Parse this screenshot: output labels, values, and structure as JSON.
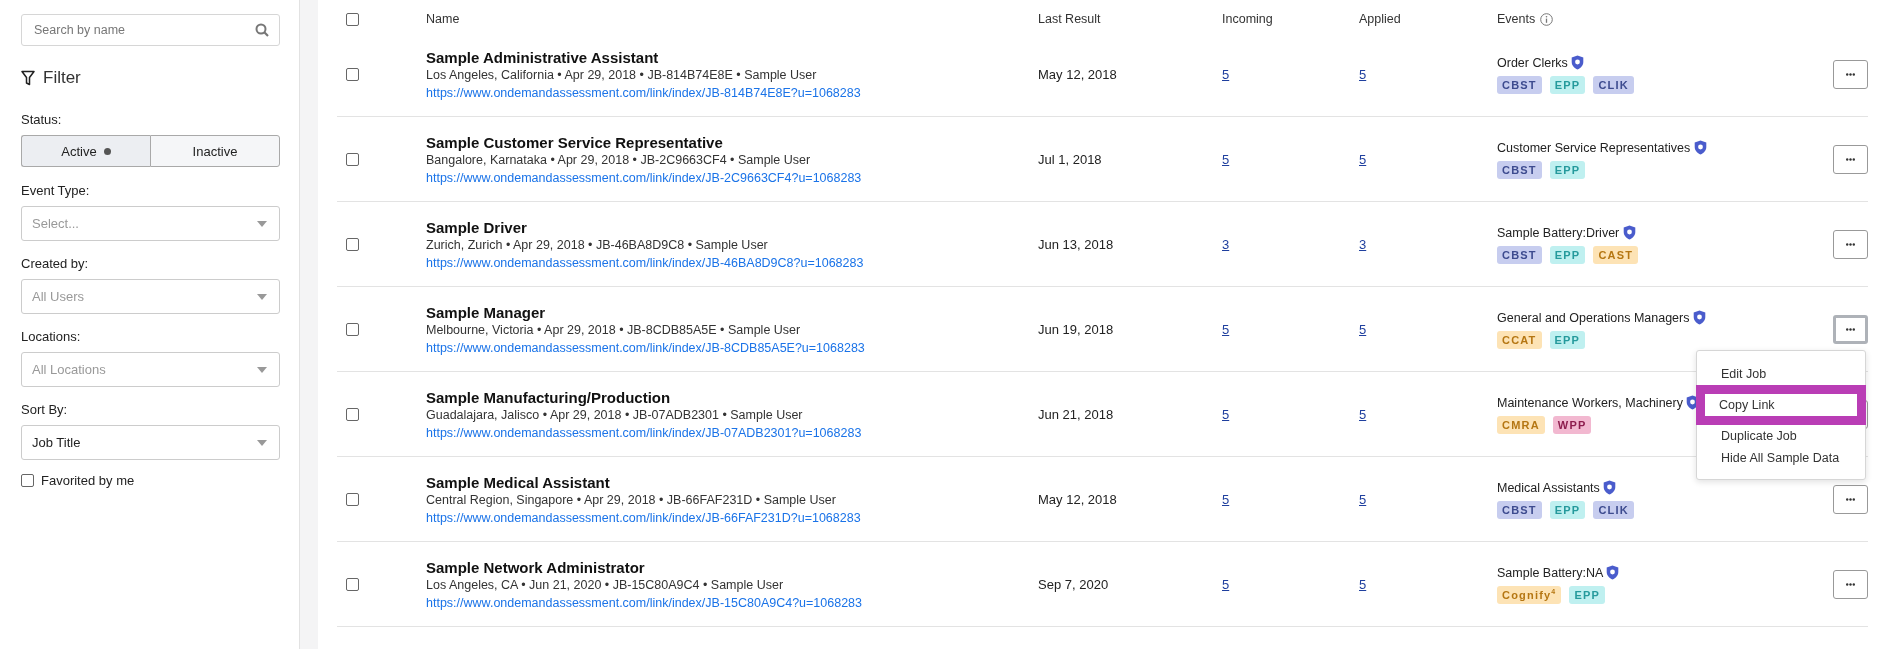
{
  "sidebar": {
    "search": {
      "placeholder": "Search by name"
    },
    "filter_title": "Filter",
    "status": {
      "label": "Status:",
      "options": [
        {
          "label": "Active",
          "selected": true
        },
        {
          "label": "Inactive",
          "selected": false
        }
      ]
    },
    "selects": [
      {
        "label": "Event Type:",
        "value": "Select...",
        "placeholder": true
      },
      {
        "label": "Created by:",
        "value": "All Users",
        "placeholder": true
      },
      {
        "label": "Locations:",
        "value": "All Locations",
        "placeholder": true
      },
      {
        "label": "Sort By:",
        "value": "Job Title",
        "placeholder": false
      }
    ],
    "favorited": {
      "label": "Favorited by me",
      "checked": false
    }
  },
  "table": {
    "select_all": {
      "checked": false
    },
    "columns": [
      "Name",
      "Last Result",
      "Incoming",
      "Applied",
      "Events"
    ],
    "rows": [
      {
        "checked": false,
        "name": "Sample Administrative Assistant",
        "meta": "Los Angeles, California • Apr 29, 2018 • JB-814B74E8E • Sample User",
        "link": "https://www.ondemandassessment.com/link/index/JB-814B74E8E?u=1068283",
        "last_result": "May 12, 2018",
        "incoming": "5",
        "applied": "5",
        "event": "Order Clerks",
        "tags": [
          {
            "label": "CBST",
            "color": "#c7cdef"
          },
          {
            "label": "EPP",
            "color": "#bff0f0"
          },
          {
            "label": "CLIK",
            "color": "#c7cdef"
          }
        ]
      },
      {
        "checked": false,
        "name": "Sample Customer Service Representative",
        "meta": "Bangalore, Karnataka • Apr 29, 2018 • JB-2C9663CF4 • Sample User",
        "link": "https://www.ondemandassessment.com/link/index/JB-2C9663CF4?u=1068283",
        "last_result": "Jul 1, 2018",
        "incoming": "5",
        "applied": "5",
        "event": "Customer Service Representatives",
        "tags": [
          {
            "label": "CBST",
            "color": "#c7cdef"
          },
          {
            "label": "EPP",
            "color": "#bff0f0"
          }
        ]
      },
      {
        "checked": false,
        "name": "Sample Driver",
        "meta": "Zurich, Zurich • Apr 29, 2018 • JB-46BA8D9C8 • Sample User",
        "link": "https://www.ondemandassessment.com/link/index/JB-46BA8D9C8?u=1068283",
        "last_result": "Jun 13, 2018",
        "incoming": "3",
        "applied": "3",
        "event": "Sample Battery:Driver",
        "tags": [
          {
            "label": "CBST",
            "color": "#c7cdef"
          },
          {
            "label": "EPP",
            "color": "#bff0f0"
          },
          {
            "label": "CAST",
            "color": "#fde3b5"
          }
        ]
      },
      {
        "checked": false,
        "name": "Sample Manager",
        "meta": "Melbourne, Victoria • Apr 29, 2018 • JB-8CDB85A5E • Sample User",
        "link": "https://www.ondemandassessment.com/link/index/JB-8CDB85A5E?u=1068283",
        "last_result": "Jun 19, 2018",
        "incoming": "5",
        "applied": "5",
        "event": "General and Operations Managers",
        "tags": [
          {
            "label": "CCAT",
            "color": "#fde3b5"
          },
          {
            "label": "EPP",
            "color": "#bff0f0"
          }
        ],
        "menu": {
          "items": [
            {
              "label": "Edit Job",
              "selected": false
            },
            {
              "label": "Copy Link",
              "selected": true
            },
            {
              "label": "Duplicate Job",
              "selected": false
            },
            {
              "label": "Hide All Sample Data",
              "selected": false
            }
          ]
        }
      },
      {
        "checked": false,
        "name": "Sample Manufacturing/Production",
        "meta": "Guadalajara, Jalisco • Apr 29, 2018 • JB-07ADB2301 • Sample User",
        "link": "https://www.ondemandassessment.com/link/index/JB-07ADB2301?u=1068283",
        "last_result": "Jun 21, 2018",
        "incoming": "5",
        "applied": "5",
        "event": "Maintenance Workers, Machinery",
        "tags": [
          {
            "label": "CMRA",
            "color": "#fde3b5"
          },
          {
            "label": "WPP",
            "color": "#f2b8d0"
          }
        ]
      },
      {
        "checked": false,
        "name": "Sample Medical Assistant",
        "meta": "Central Region, Singapore • Apr 29, 2018 • JB-66FAF231D • Sample User",
        "link": "https://www.ondemandassessment.com/link/index/JB-66FAF231D?u=1068283",
        "last_result": "May 12, 2018",
        "incoming": "5",
        "applied": "5",
        "event": "Medical Assistants",
        "tags": [
          {
            "label": "CBST",
            "color": "#c7cdef"
          },
          {
            "label": "EPP",
            "color": "#bff0f0"
          },
          {
            "label": "CLIK",
            "color": "#c7cdef"
          }
        ]
      },
      {
        "checked": false,
        "name": "Sample Network Administrator",
        "meta": "Los Angeles, CA • Jun 21, 2020 • JB-15C80A9C4 • Sample User",
        "link": "https://www.ondemandassessment.com/link/index/JB-15C80A9C4?u=1068283",
        "last_result": "Sep 7, 2020",
        "incoming": "5",
        "applied": "5",
        "event": "Sample Battery:NA",
        "tags": [
          {
            "label": "Cognify$^{4}$",
            "color": "#fde3b5"
          },
          {
            "label": "EPP",
            "color": "#bff0f0"
          }
        ]
      }
    ]
  }
}
